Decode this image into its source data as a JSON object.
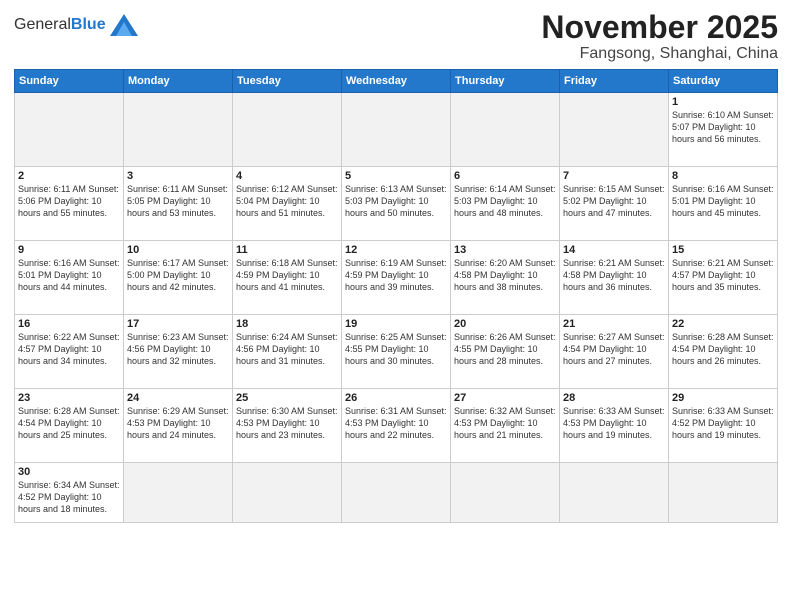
{
  "header": {
    "logo_general": "General",
    "logo_blue": "Blue",
    "month_title": "November 2025",
    "location": "Fangsong, Shanghai, China"
  },
  "weekdays": [
    "Sunday",
    "Monday",
    "Tuesday",
    "Wednesday",
    "Thursday",
    "Friday",
    "Saturday"
  ],
  "weeks": [
    [
      {
        "day": "",
        "empty": true
      },
      {
        "day": "",
        "empty": true
      },
      {
        "day": "",
        "empty": true
      },
      {
        "day": "",
        "empty": true
      },
      {
        "day": "",
        "empty": true
      },
      {
        "day": "",
        "empty": true
      },
      {
        "day": "1",
        "info": "Sunrise: 6:10 AM\nSunset: 5:07 PM\nDaylight: 10 hours\nand 56 minutes."
      }
    ],
    [
      {
        "day": "2",
        "info": "Sunrise: 6:11 AM\nSunset: 5:06 PM\nDaylight: 10 hours\nand 55 minutes."
      },
      {
        "day": "3",
        "info": "Sunrise: 6:11 AM\nSunset: 5:05 PM\nDaylight: 10 hours\nand 53 minutes."
      },
      {
        "day": "4",
        "info": "Sunrise: 6:12 AM\nSunset: 5:04 PM\nDaylight: 10 hours\nand 51 minutes."
      },
      {
        "day": "5",
        "info": "Sunrise: 6:13 AM\nSunset: 5:03 PM\nDaylight: 10 hours\nand 50 minutes."
      },
      {
        "day": "6",
        "info": "Sunrise: 6:14 AM\nSunset: 5:03 PM\nDaylight: 10 hours\nand 48 minutes."
      },
      {
        "day": "7",
        "info": "Sunrise: 6:15 AM\nSunset: 5:02 PM\nDaylight: 10 hours\nand 47 minutes."
      },
      {
        "day": "8",
        "info": "Sunrise: 6:16 AM\nSunset: 5:01 PM\nDaylight: 10 hours\nand 45 minutes."
      }
    ],
    [
      {
        "day": "9",
        "info": "Sunrise: 6:16 AM\nSunset: 5:01 PM\nDaylight: 10 hours\nand 44 minutes."
      },
      {
        "day": "10",
        "info": "Sunrise: 6:17 AM\nSunset: 5:00 PM\nDaylight: 10 hours\nand 42 minutes."
      },
      {
        "day": "11",
        "info": "Sunrise: 6:18 AM\nSunset: 4:59 PM\nDaylight: 10 hours\nand 41 minutes."
      },
      {
        "day": "12",
        "info": "Sunrise: 6:19 AM\nSunset: 4:59 PM\nDaylight: 10 hours\nand 39 minutes."
      },
      {
        "day": "13",
        "info": "Sunrise: 6:20 AM\nSunset: 4:58 PM\nDaylight: 10 hours\nand 38 minutes."
      },
      {
        "day": "14",
        "info": "Sunrise: 6:21 AM\nSunset: 4:58 PM\nDaylight: 10 hours\nand 36 minutes."
      },
      {
        "day": "15",
        "info": "Sunrise: 6:21 AM\nSunset: 4:57 PM\nDaylight: 10 hours\nand 35 minutes."
      }
    ],
    [
      {
        "day": "16",
        "info": "Sunrise: 6:22 AM\nSunset: 4:57 PM\nDaylight: 10 hours\nand 34 minutes."
      },
      {
        "day": "17",
        "info": "Sunrise: 6:23 AM\nSunset: 4:56 PM\nDaylight: 10 hours\nand 32 minutes."
      },
      {
        "day": "18",
        "info": "Sunrise: 6:24 AM\nSunset: 4:56 PM\nDaylight: 10 hours\nand 31 minutes."
      },
      {
        "day": "19",
        "info": "Sunrise: 6:25 AM\nSunset: 4:55 PM\nDaylight: 10 hours\nand 30 minutes."
      },
      {
        "day": "20",
        "info": "Sunrise: 6:26 AM\nSunset: 4:55 PM\nDaylight: 10 hours\nand 28 minutes."
      },
      {
        "day": "21",
        "info": "Sunrise: 6:27 AM\nSunset: 4:54 PM\nDaylight: 10 hours\nand 27 minutes."
      },
      {
        "day": "22",
        "info": "Sunrise: 6:28 AM\nSunset: 4:54 PM\nDaylight: 10 hours\nand 26 minutes."
      }
    ],
    [
      {
        "day": "23",
        "info": "Sunrise: 6:28 AM\nSunset: 4:54 PM\nDaylight: 10 hours\nand 25 minutes."
      },
      {
        "day": "24",
        "info": "Sunrise: 6:29 AM\nSunset: 4:53 PM\nDaylight: 10 hours\nand 24 minutes."
      },
      {
        "day": "25",
        "info": "Sunrise: 6:30 AM\nSunset: 4:53 PM\nDaylight: 10 hours\nand 23 minutes."
      },
      {
        "day": "26",
        "info": "Sunrise: 6:31 AM\nSunset: 4:53 PM\nDaylight: 10 hours\nand 22 minutes."
      },
      {
        "day": "27",
        "info": "Sunrise: 6:32 AM\nSunset: 4:53 PM\nDaylight: 10 hours\nand 21 minutes."
      },
      {
        "day": "28",
        "info": "Sunrise: 6:33 AM\nSunset: 4:53 PM\nDaylight: 10 hours\nand 19 minutes."
      },
      {
        "day": "29",
        "info": "Sunrise: 6:33 AM\nSunset: 4:52 PM\nDaylight: 10 hours\nand 19 minutes."
      }
    ],
    [
      {
        "day": "30",
        "info": "Sunrise: 6:34 AM\nSunset: 4:52 PM\nDaylight: 10 hours\nand 18 minutes."
      },
      {
        "day": "",
        "empty": true
      },
      {
        "day": "",
        "empty": true
      },
      {
        "day": "",
        "empty": true
      },
      {
        "day": "",
        "empty": true
      },
      {
        "day": "",
        "empty": true
      },
      {
        "day": "",
        "empty": true
      }
    ]
  ],
  "colors": {
    "header_bg": "#2478cc",
    "empty_bg": "#f2f2f2"
  }
}
